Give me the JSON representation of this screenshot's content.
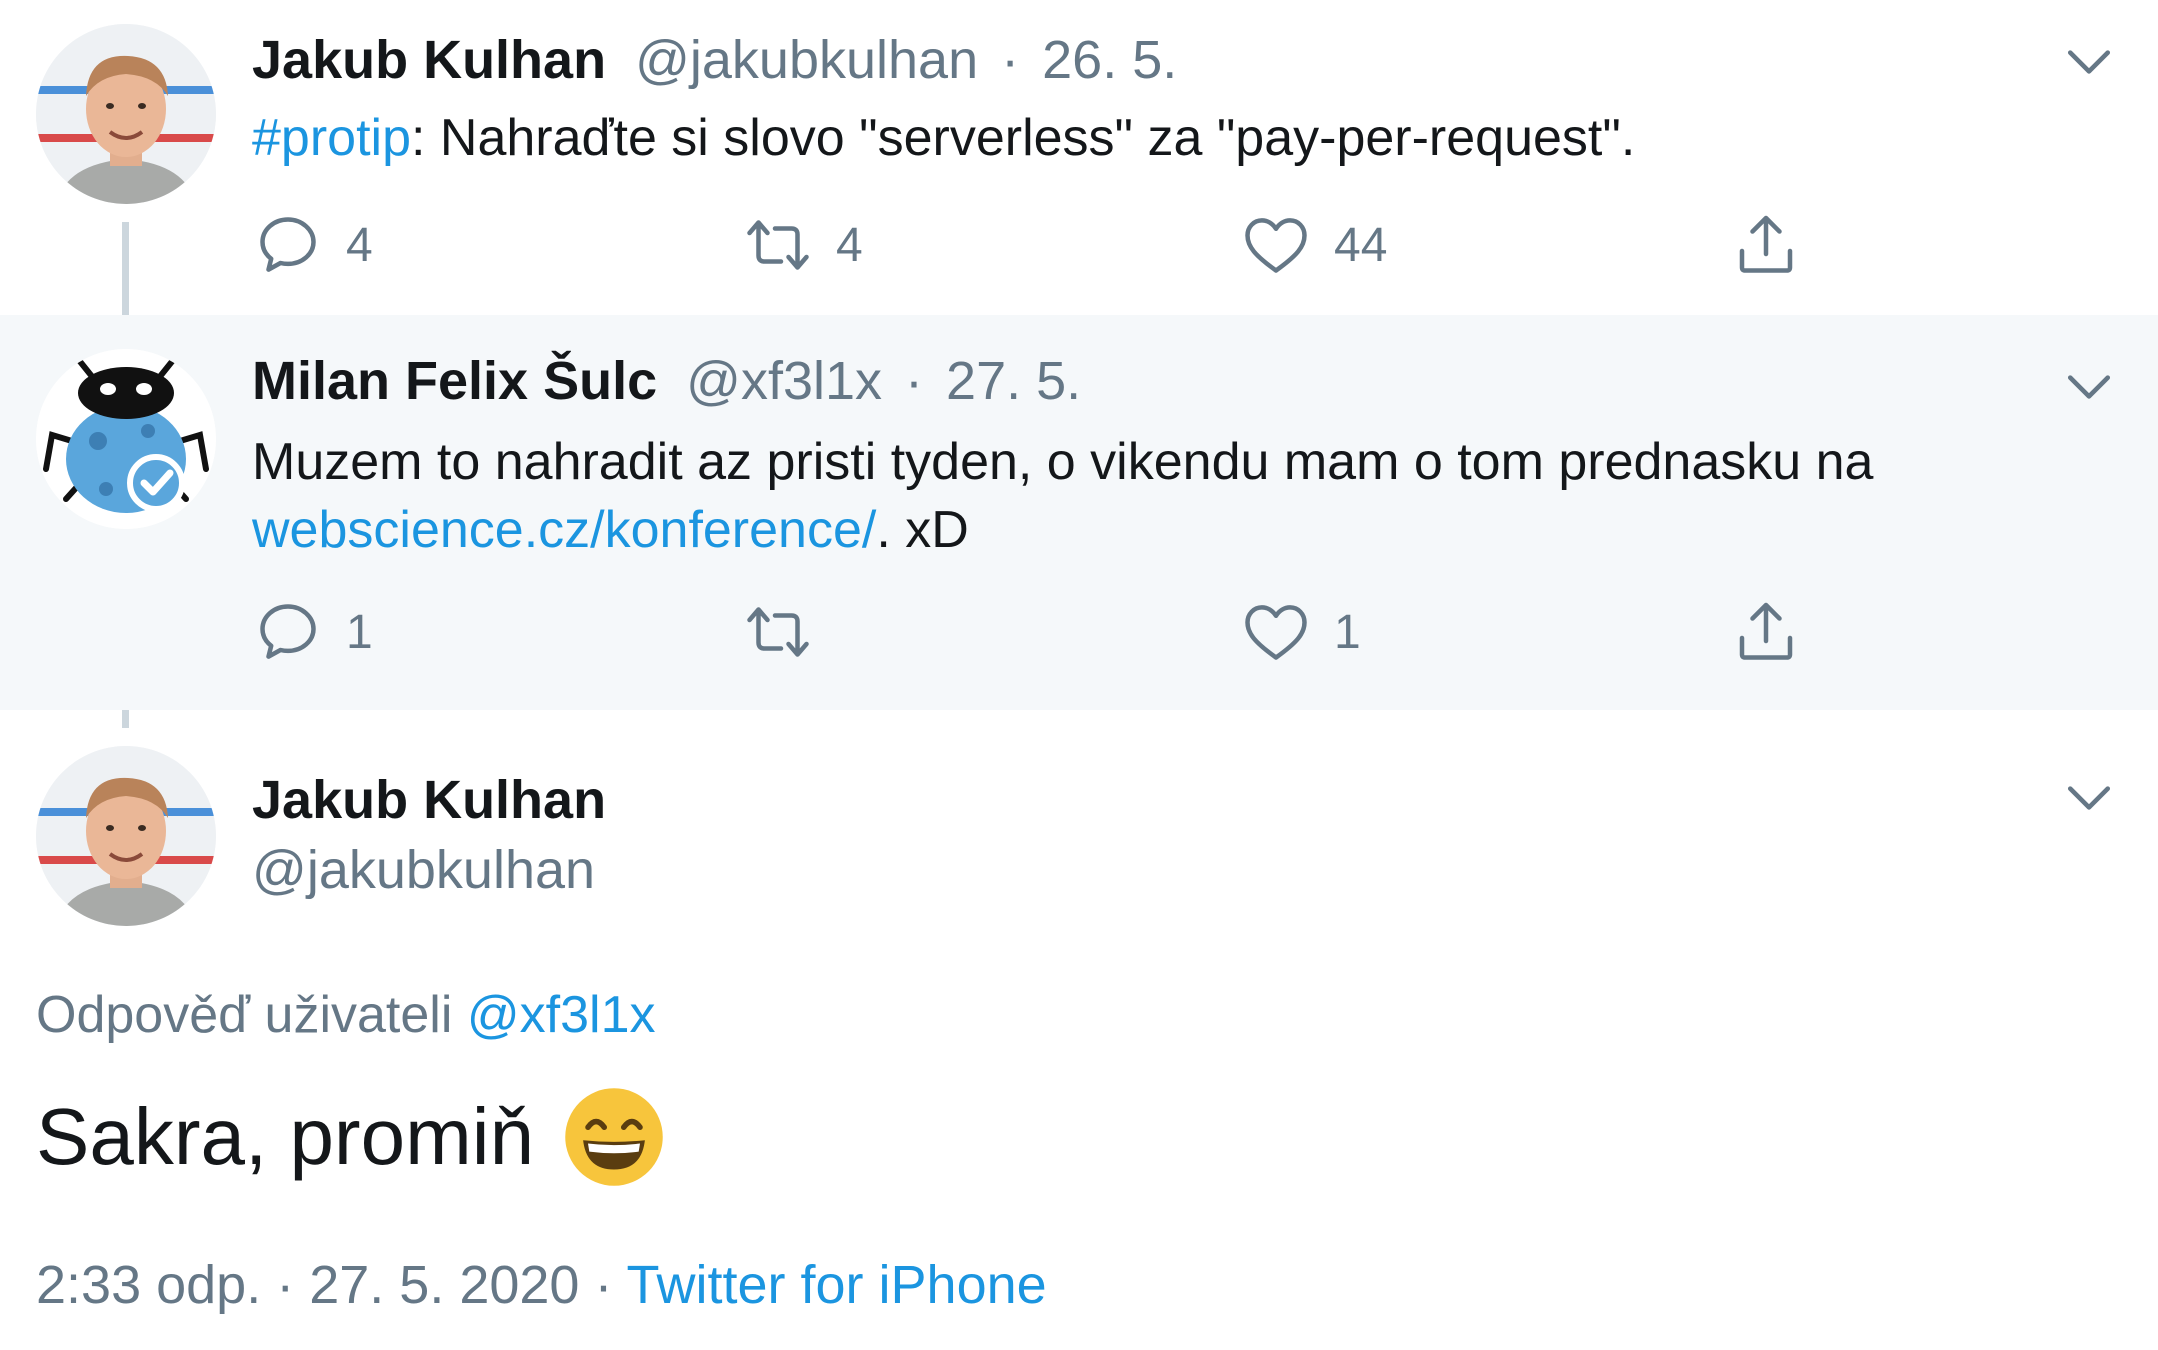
{
  "tweets": [
    {
      "author_name": "Jakub Kulhan",
      "handle": "@jakubkulhan",
      "separator": "·",
      "date": "26. 5.",
      "hashtag": "#protip",
      "text": ": Nahraďte si slovo \"serverless\" za \"pay-per-request\".",
      "reply_count": "4",
      "retweet_count": "4",
      "like_count": "44"
    },
    {
      "author_name": "Milan Felix Šulc",
      "handle": "@xf3l1x",
      "separator": "·",
      "date": "27. 5.",
      "text_line1": "Muzem to nahradit az pristi tyden, o vikendu mam o tom prednasku na",
      "link": "webscience.cz/konference/",
      "text_after_link": ". xD",
      "reply_count": "1",
      "retweet_count": "",
      "like_count": "1"
    }
  ],
  "main_tweet": {
    "author_name": "Jakub Kulhan",
    "handle": "@jakubkulhan",
    "reply_prefix": "Odpověď uživateli",
    "reply_handle": "@xf3l1x",
    "text": "Sakra, promiň",
    "emoji": "grinning-face-with-smiling-eyes-emoji",
    "time": "2:33 odp.",
    "separator": "·",
    "date": "27. 5. 2020",
    "source": "Twitter for iPhone"
  },
  "colors": {
    "link": "#1b95e0",
    "muted": "#657786",
    "highlight_bg": "#f5f8fa",
    "thread_line": "#ccd6dd"
  }
}
